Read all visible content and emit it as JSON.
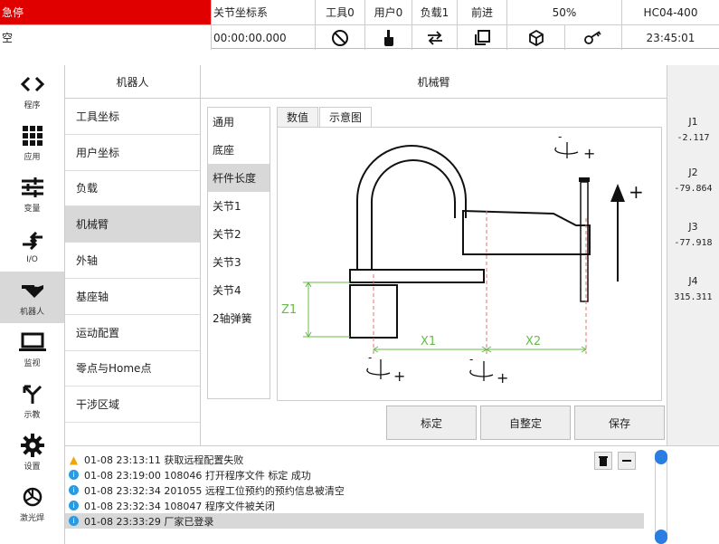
{
  "topbar": {
    "row1": {
      "estop": "急停",
      "coord": "关节坐标系",
      "tool": "工具0",
      "user": "用户0",
      "load": "负载1",
      "direction": "前进",
      "speed": "50%",
      "model": "HC04-400"
    },
    "row2": {
      "mode": "空",
      "timer": "00:00:00.000",
      "clock": "23:45:01"
    },
    "colors": {
      "estop": "#e00000"
    }
  },
  "leftnav": {
    "items": [
      {
        "label": "程序",
        "icon": "code-brackets-icon"
      },
      {
        "label": "应用",
        "icon": "grid-icon"
      },
      {
        "label": "变量",
        "icon": "sliders-icon"
      },
      {
        "label": "I/O",
        "icon": "io-arrows-icon"
      },
      {
        "label": "机器人",
        "icon": "robot-icon"
      },
      {
        "label": "监视",
        "icon": "laptop-icon"
      },
      {
        "label": "示教",
        "icon": "teach-arrow-icon"
      },
      {
        "label": "设置",
        "icon": "gear-icon"
      },
      {
        "label": "激光焊",
        "icon": "laser-weld-icon"
      }
    ]
  },
  "submenu": {
    "title": "机器人",
    "items": [
      "工具坐标",
      "用户坐标",
      "负载",
      "机械臂",
      "外轴",
      "基座轴",
      "运动配置",
      "零点与Home点",
      "干涉区域"
    ]
  },
  "main": {
    "title": "机械臂",
    "inner_menu": [
      "通用",
      "底座",
      "杆件长度",
      "关节1",
      "关节2",
      "关节3",
      "关节4",
      "2轴弹簧"
    ],
    "tabs": [
      "数值",
      "示意图"
    ],
    "diagram_labels": {
      "z1": "Z1",
      "x1": "X1",
      "x2": "X2"
    },
    "buttons": [
      "标定",
      "自整定",
      "保存"
    ]
  },
  "joints": [
    {
      "name": "J1",
      "value": "-2.117"
    },
    {
      "name": "J2",
      "value": "-79.864"
    },
    {
      "name": "J3",
      "value": "-77.918"
    },
    {
      "name": "J4",
      "value": "315.311"
    }
  ],
  "log": {
    "entries": [
      {
        "type": "warn",
        "text": "01-08 23:13:11 获取远程配置失败"
      },
      {
        "type": "info",
        "text": "01-08 23:19:00 108046 打开程序文件 标定 成功"
      },
      {
        "type": "info",
        "text": "01-08 23:32:34 201055 远程工位预约的预约信息被清空"
      },
      {
        "type": "info",
        "text": "01-08 23:32:34 108047 程序文件被关闭"
      },
      {
        "type": "info",
        "text": "01-08 23:33:29 厂家已登录"
      }
    ]
  }
}
